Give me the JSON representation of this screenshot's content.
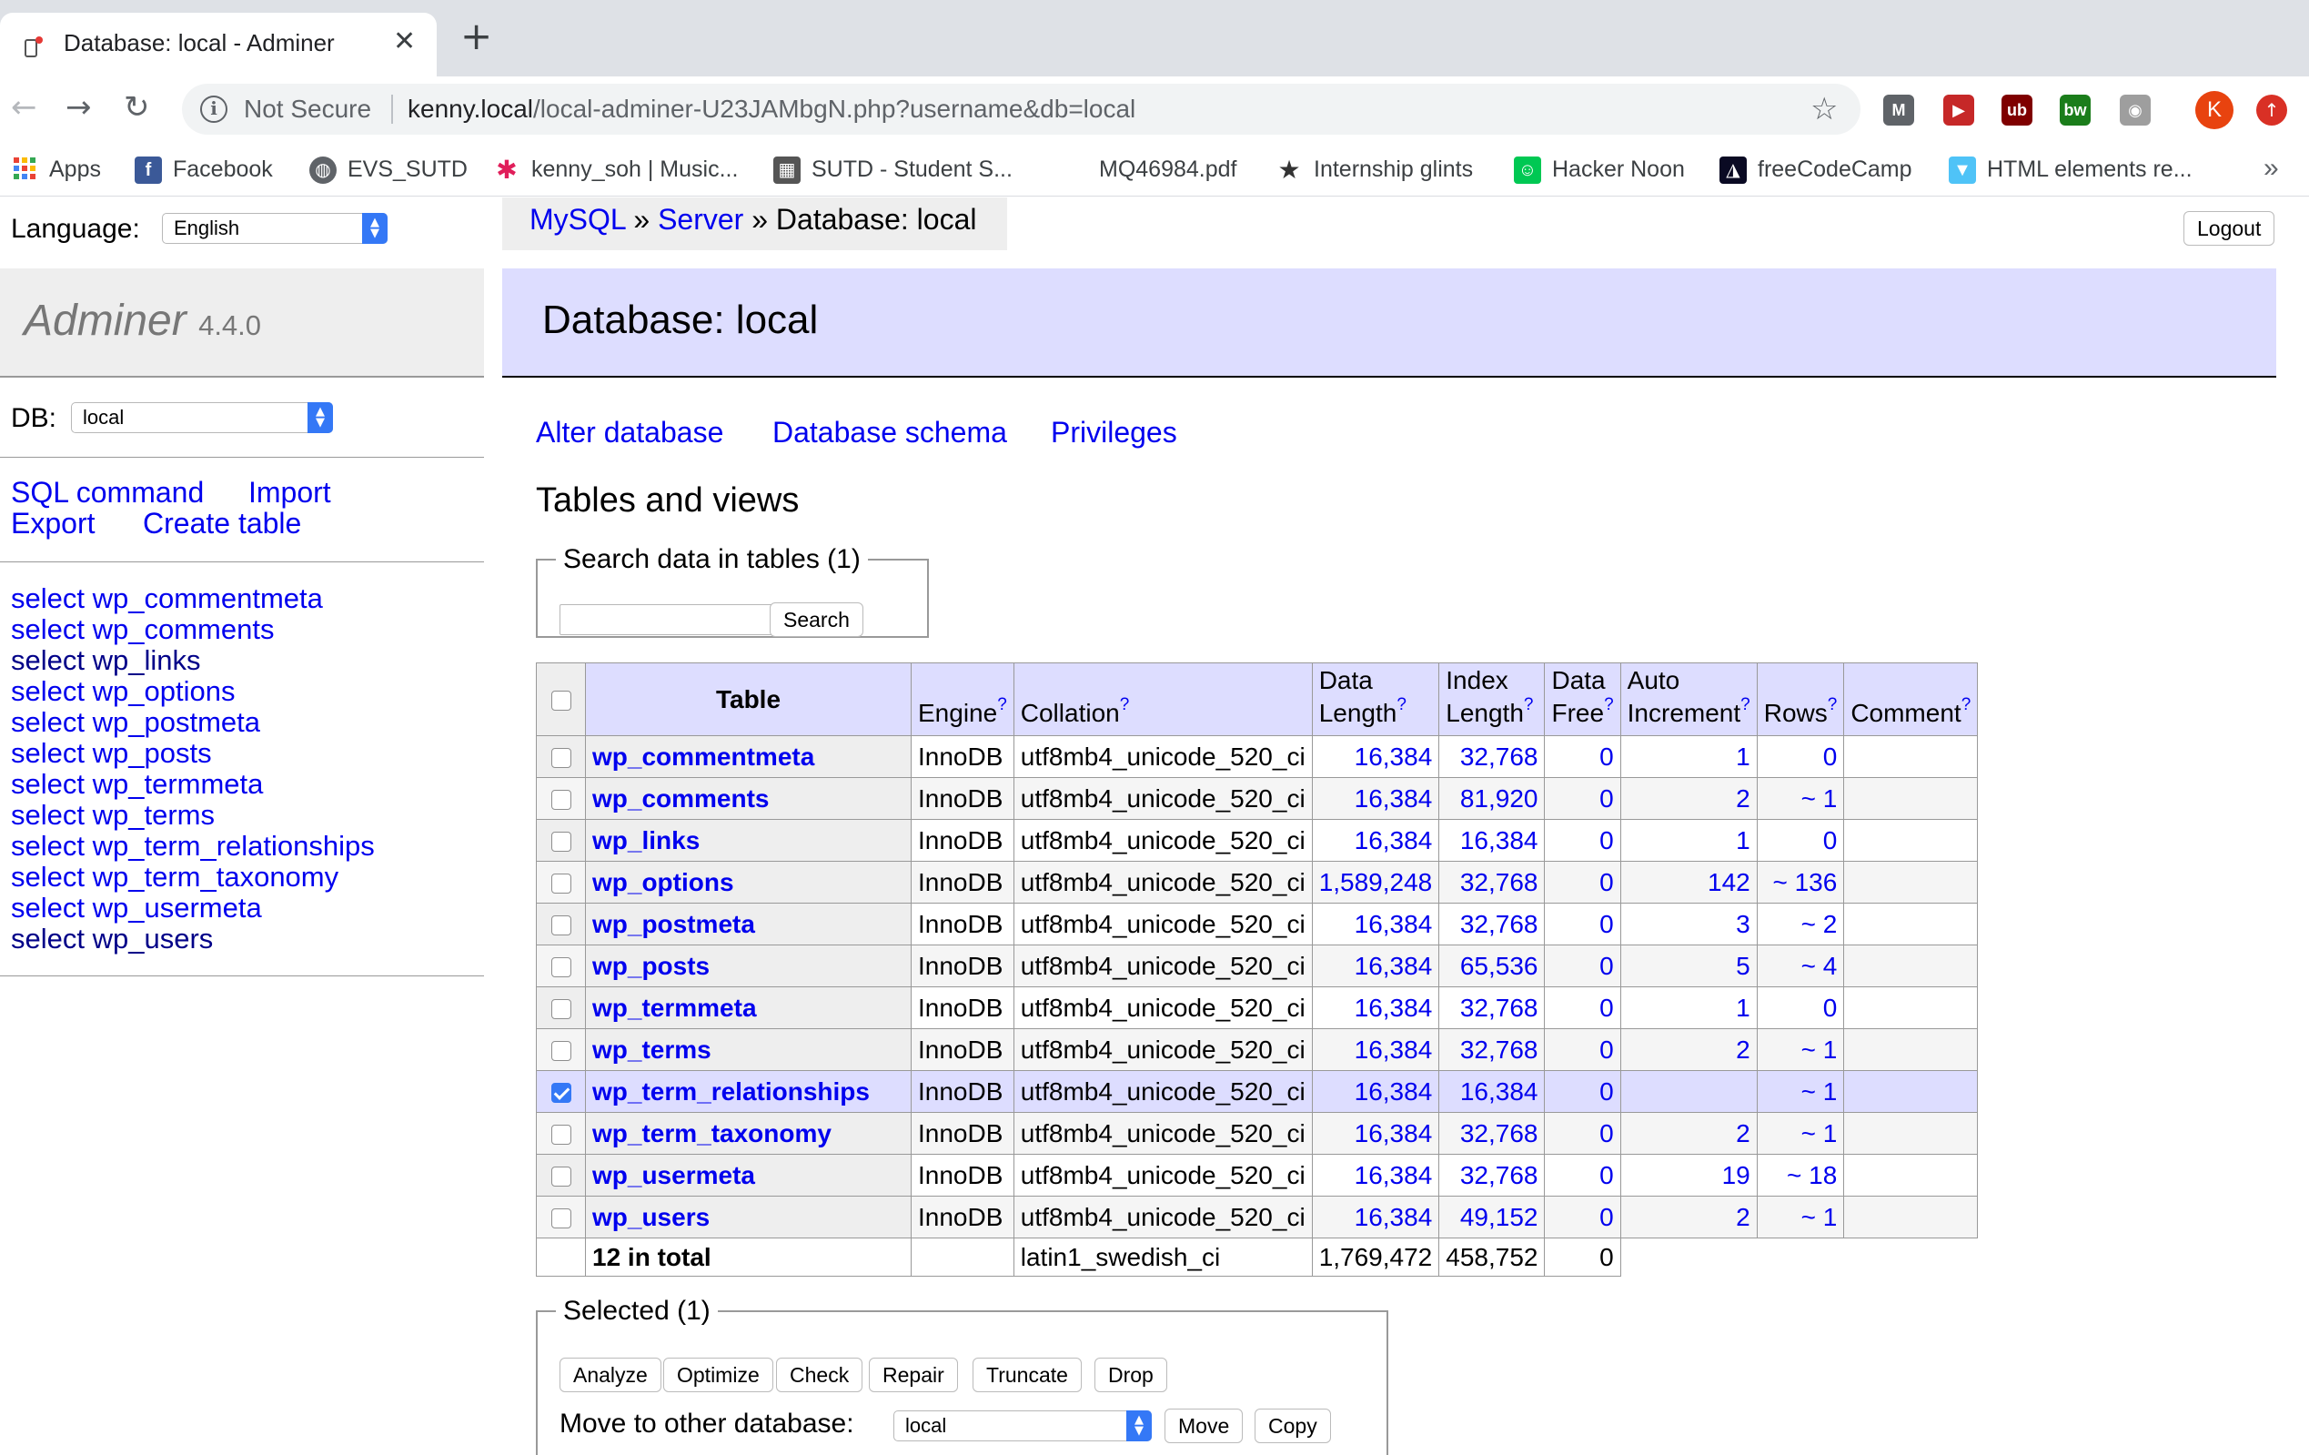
{
  "browser": {
    "tab_title": "Database: local - Adminer",
    "tab_close": "✕",
    "new_tab": "+",
    "back": "←",
    "forward": "→",
    "reload": "↻",
    "not_secure": "Not Secure",
    "url_host": "kenny.local",
    "url_path": "/local-adminer-U23JAMbgN.php?username&db=local",
    "star": "☆",
    "profile_initial": "K",
    "extensions": [
      {
        "name": "M",
        "color": "#5f6368"
      },
      {
        "name": "▶",
        "color": "#c62828"
      },
      {
        "name": "ub",
        "color": "#7f0000"
      },
      {
        "name": "bw",
        "color": "#1b7d1b"
      },
      {
        "name": "◉",
        "color": "#9e9e9e"
      }
    ],
    "bookmarks": [
      "Apps",
      "Facebook",
      "EVS_SUTD",
      "kenny_soh | Music...",
      "SUTD - Student S...",
      "MQ46984.pdf",
      "Internship glints",
      "Hacker Noon",
      "freeCodeCamp",
      "HTML elements re..."
    ],
    "bookmarks_more": "»"
  },
  "sidebar": {
    "language_label": "Language:",
    "language_value": "English",
    "brand": "Adminer",
    "version": "4.4.0",
    "db_label": "DB:",
    "db_value": "local",
    "links": {
      "sql_command": "SQL command",
      "import": "Import",
      "export": "Export",
      "create_table": "Create table"
    },
    "select_word": "select",
    "tables": [
      "wp_commentmeta",
      "wp_comments",
      "wp_links",
      "wp_options",
      "wp_postmeta",
      "wp_posts",
      "wp_termmeta",
      "wp_terms",
      "wp_term_relationships",
      "wp_term_taxonomy",
      "wp_usermeta",
      "wp_users"
    ]
  },
  "breadcrumb": {
    "mysql": "MySQL",
    "sep": "»",
    "server": "Server",
    "current": "Database: local"
  },
  "logout": "Logout",
  "main": {
    "title": "Database: local",
    "links": {
      "alter": "Alter database",
      "schema": "Database schema",
      "privileges": "Privileges"
    },
    "heading": "Tables and views",
    "search_legend": "Search data in tables (1)",
    "search_button": "Search",
    "columns": {
      "table": "Table",
      "engine": "Engine",
      "collation": "Collation",
      "data_length_1": "Data",
      "data_length_2": "Length",
      "index_length_1": "Index",
      "index_length_2": "Length",
      "data_free_1": "Data",
      "data_free_2": "Free",
      "auto_inc_1": "Auto",
      "auto_inc_2": "Increment",
      "rows": "Rows",
      "comment": "Comment",
      "help": "?"
    },
    "rows": [
      {
        "name": "wp_commentmeta",
        "engine": "InnoDB",
        "collation": "utf8mb4_unicode_520_ci",
        "data_length": "16,384",
        "index_length": "32,768",
        "data_free": "0",
        "auto_increment": "1",
        "rows": "0",
        "checked": false
      },
      {
        "name": "wp_comments",
        "engine": "InnoDB",
        "collation": "utf8mb4_unicode_520_ci",
        "data_length": "16,384",
        "index_length": "81,920",
        "data_free": "0",
        "auto_increment": "2",
        "rows": "~ 1",
        "checked": false
      },
      {
        "name": "wp_links",
        "engine": "InnoDB",
        "collation": "utf8mb4_unicode_520_ci",
        "data_length": "16,384",
        "index_length": "16,384",
        "data_free": "0",
        "auto_increment": "1",
        "rows": "0",
        "checked": false
      },
      {
        "name": "wp_options",
        "engine": "InnoDB",
        "collation": "utf8mb4_unicode_520_ci",
        "data_length": "1,589,248",
        "index_length": "32,768",
        "data_free": "0",
        "auto_increment": "142",
        "rows": "~ 136",
        "checked": false
      },
      {
        "name": "wp_postmeta",
        "engine": "InnoDB",
        "collation": "utf8mb4_unicode_520_ci",
        "data_length": "16,384",
        "index_length": "32,768",
        "data_free": "0",
        "auto_increment": "3",
        "rows": "~ 2",
        "checked": false
      },
      {
        "name": "wp_posts",
        "engine": "InnoDB",
        "collation": "utf8mb4_unicode_520_ci",
        "data_length": "16,384",
        "index_length": "65,536",
        "data_free": "0",
        "auto_increment": "5",
        "rows": "~ 4",
        "checked": false
      },
      {
        "name": "wp_termmeta",
        "engine": "InnoDB",
        "collation": "utf8mb4_unicode_520_ci",
        "data_length": "16,384",
        "index_length": "32,768",
        "data_free": "0",
        "auto_increment": "1",
        "rows": "0",
        "checked": false
      },
      {
        "name": "wp_terms",
        "engine": "InnoDB",
        "collation": "utf8mb4_unicode_520_ci",
        "data_length": "16,384",
        "index_length": "32,768",
        "data_free": "0",
        "auto_increment": "2",
        "rows": "~ 1",
        "checked": false
      },
      {
        "name": "wp_term_relationships",
        "engine": "InnoDB",
        "collation": "utf8mb4_unicode_520_ci",
        "data_length": "16,384",
        "index_length": "16,384",
        "data_free": "0",
        "auto_increment": "",
        "rows": "~ 1",
        "checked": true
      },
      {
        "name": "wp_term_taxonomy",
        "engine": "InnoDB",
        "collation": "utf8mb4_unicode_520_ci",
        "data_length": "16,384",
        "index_length": "32,768",
        "data_free": "0",
        "auto_increment": "2",
        "rows": "~ 1",
        "checked": false
      },
      {
        "name": "wp_usermeta",
        "engine": "InnoDB",
        "collation": "utf8mb4_unicode_520_ci",
        "data_length": "16,384",
        "index_length": "32,768",
        "data_free": "0",
        "auto_increment": "19",
        "rows": "~ 18",
        "checked": false
      },
      {
        "name": "wp_users",
        "engine": "InnoDB",
        "collation": "utf8mb4_unicode_520_ci",
        "data_length": "16,384",
        "index_length": "49,152",
        "data_free": "0",
        "auto_increment": "2",
        "rows": "~ 1",
        "checked": false
      }
    ],
    "total": {
      "label": "12 in total",
      "collation": "latin1_swedish_ci",
      "data_length": "1,769,472",
      "index_length": "458,752",
      "data_free": "0"
    },
    "selected_legend": "Selected (1)",
    "actions": [
      "Analyze",
      "Optimize",
      "Check",
      "Repair",
      "Truncate",
      "Drop"
    ],
    "move_label": "Move to other database:",
    "move_value": "local",
    "move_button": "Move",
    "copy_button": "Copy"
  }
}
